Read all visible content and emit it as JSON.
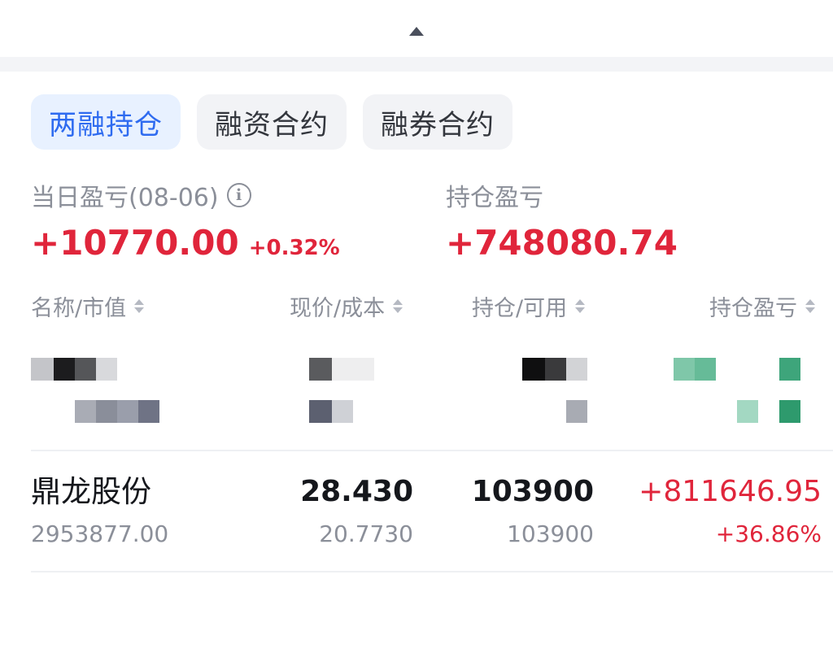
{
  "tabs": [
    {
      "label": "两融持仓",
      "active": true
    },
    {
      "label": "融资合约",
      "active": false
    },
    {
      "label": "融券合约",
      "active": false
    }
  ],
  "summary": {
    "daily_label": "当日盈亏(08-06)",
    "daily_value": "+10770.00",
    "daily_pct": "+0.32%",
    "position_label": "持仓盈亏",
    "position_value": "+748080.74"
  },
  "columns": {
    "name": "名称/市值",
    "price": "现价/成本",
    "holding": "持仓/可用",
    "pnl": "持仓盈亏"
  },
  "holdings": [
    {
      "name": "鼎龙股份",
      "market_value": "2953877.00",
      "price": "28.430",
      "cost": "20.7730",
      "holding": "103900",
      "available": "103900",
      "pnl": "+811646.95",
      "pnl_pct": "+36.86%"
    }
  ],
  "icons": {
    "collapse": "chevron-up-icon",
    "info": "info-icon",
    "sort": "sort-icon"
  },
  "colors": {
    "accent": "#2e6bf0",
    "gain": "#e0253b",
    "loss": "#2aa36f"
  }
}
